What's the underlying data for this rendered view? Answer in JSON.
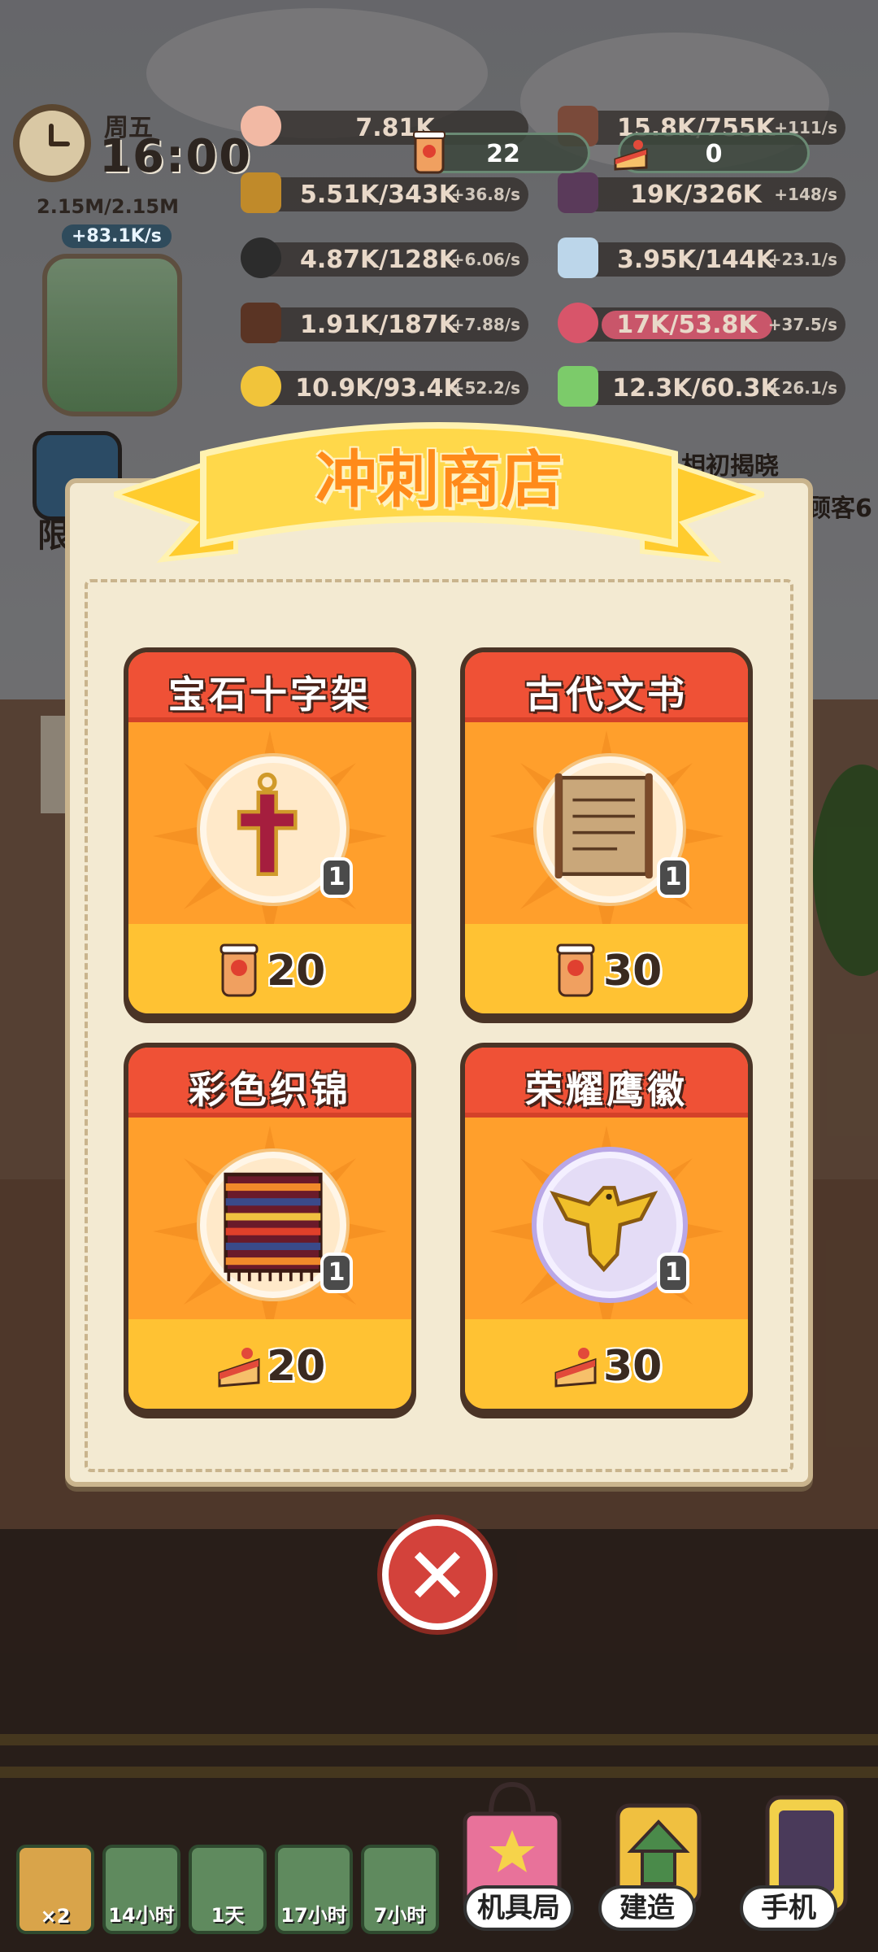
{
  "hud": {
    "day": "周五",
    "time": "16:00",
    "capacity": "2.15M/2.15M",
    "rate": "+83.1K/s"
  },
  "resources": [
    {
      "value": "7.81K",
      "rate": ""
    },
    {
      "value": "15.8K/755K",
      "rate": "+111/s"
    },
    {
      "value": "5.51K/343K",
      "rate": "+36.8/s"
    },
    {
      "value": "19K/326K",
      "rate": "+148/s"
    },
    {
      "value": "4.87K/128K",
      "rate": "+6.06/s"
    },
    {
      "value": "3.95K/144K",
      "rate": "+23.1/s"
    },
    {
      "value": "1.91K/187K",
      "rate": "+7.88/s"
    },
    {
      "value": "17K/53.8K",
      "rate": "+37.5/s"
    },
    {
      "value": "10.9K/93.4K",
      "rate": "+52.2/s"
    },
    {
      "value": "12.3K/60.3K",
      "rate": "+26.1/s"
    }
  ],
  "currency": {
    "bubble_tea": "22",
    "cake": "0"
  },
  "background_text": {
    "top_right": "相初揭晓",
    "right": "顾客6",
    "left": "限"
  },
  "shop": {
    "title": "冲刺商店",
    "items": [
      {
        "name": "宝石十字架",
        "count": "1",
        "price": "20",
        "currency_icon": "bubble-tea-icon"
      },
      {
        "name": "古代文书",
        "count": "1",
        "price": "30",
        "currency_icon": "bubble-tea-icon"
      },
      {
        "name": "彩色织锦",
        "count": "1",
        "price": "20",
        "currency_icon": "cake-icon"
      },
      {
        "name": "荣耀鹰徽",
        "count": "1",
        "price": "30",
        "currency_icon": "cake-icon"
      }
    ],
    "close_icon": "close-icon"
  },
  "bottom_bar": {
    "slots": [
      {
        "label": "×2"
      },
      {
        "label": "14小时"
      },
      {
        "label": "1天"
      },
      {
        "label": "17小时"
      },
      {
        "label": "7小时"
      }
    ],
    "nav": [
      {
        "label": "机具局"
      },
      {
        "label": "建造"
      },
      {
        "label": "手机"
      }
    ]
  },
  "colors": {
    "card_header": "#ef5136",
    "card_body": "#ff9f2c",
    "card_footer": "#ffc233",
    "banner": "#ffd84a",
    "banner_text": "#ff8a1a",
    "close_button": "#d3423b"
  }
}
